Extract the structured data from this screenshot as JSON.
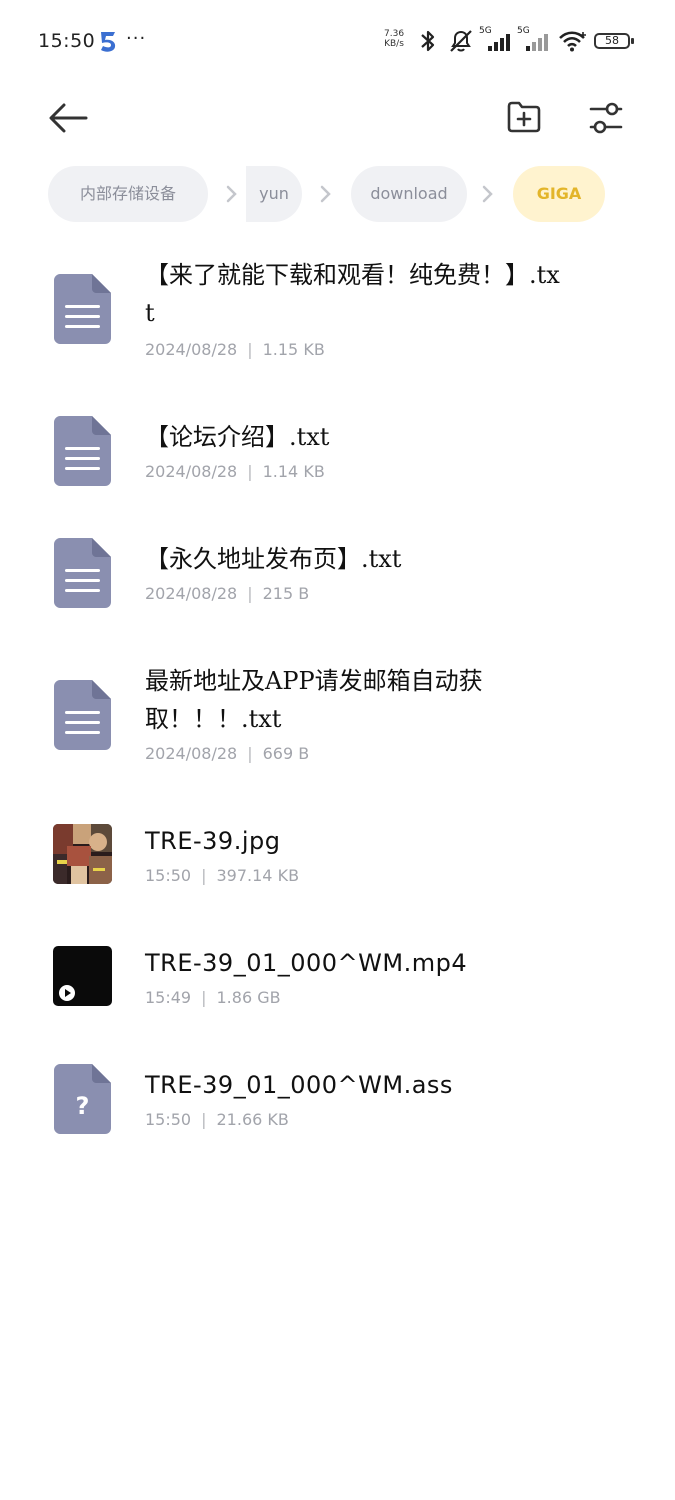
{
  "status_bar": {
    "time": "15:50",
    "more": "···",
    "net_speed_value": "7.36",
    "net_speed_unit": "KB/s",
    "sim1_label": "5G",
    "sim2_label": "5G",
    "battery": "58"
  },
  "toolbar": {
    "back_icon": "arrow-left-icon",
    "new_folder_icon": "folder-plus-icon",
    "filter_icon": "sliders-icon"
  },
  "breadcrumb": [
    {
      "label": "内部存储设备"
    },
    {
      "label": "yun"
    },
    {
      "label": "download"
    },
    {
      "label": "GIGA"
    }
  ],
  "files": [
    {
      "name": "【来了就能下载和观看！纯免费！】.txt",
      "date": "2024/08/28",
      "size": "1.15 KB",
      "type": "text"
    },
    {
      "name": "【论坛介绍】.txt",
      "date": "2024/08/28",
      "size": "1.14 KB",
      "type": "text"
    },
    {
      "name": "【永久地址发布页】.txt",
      "date": "2024/08/28",
      "size": "215 B",
      "type": "text"
    },
    {
      "name": "最新地址及APP请发邮箱自动获取！！！.txt",
      "date": "2024/08/28",
      "size": "669 B",
      "type": "text"
    },
    {
      "name": "TRE-39.jpg",
      "date": "15:50",
      "size": "397.14 KB",
      "type": "image"
    },
    {
      "name": "TRE-39_01_000^WM.mp4",
      "date": "15:49",
      "size": "1.86 GB",
      "type": "video"
    },
    {
      "name": "TRE-39_01_000^WM.ass",
      "date": "15:50",
      "size": "21.66 KB",
      "type": "unknown"
    }
  ],
  "colors": {
    "doc_icon": "#8a8fb0",
    "doc_fold": "#6f7496",
    "crumb_bg": "#f0f1f4",
    "crumb_active_bg": "#fff3cf",
    "crumb_active_text": "#e3b52a",
    "meta_text": "#a2a4ab"
  }
}
